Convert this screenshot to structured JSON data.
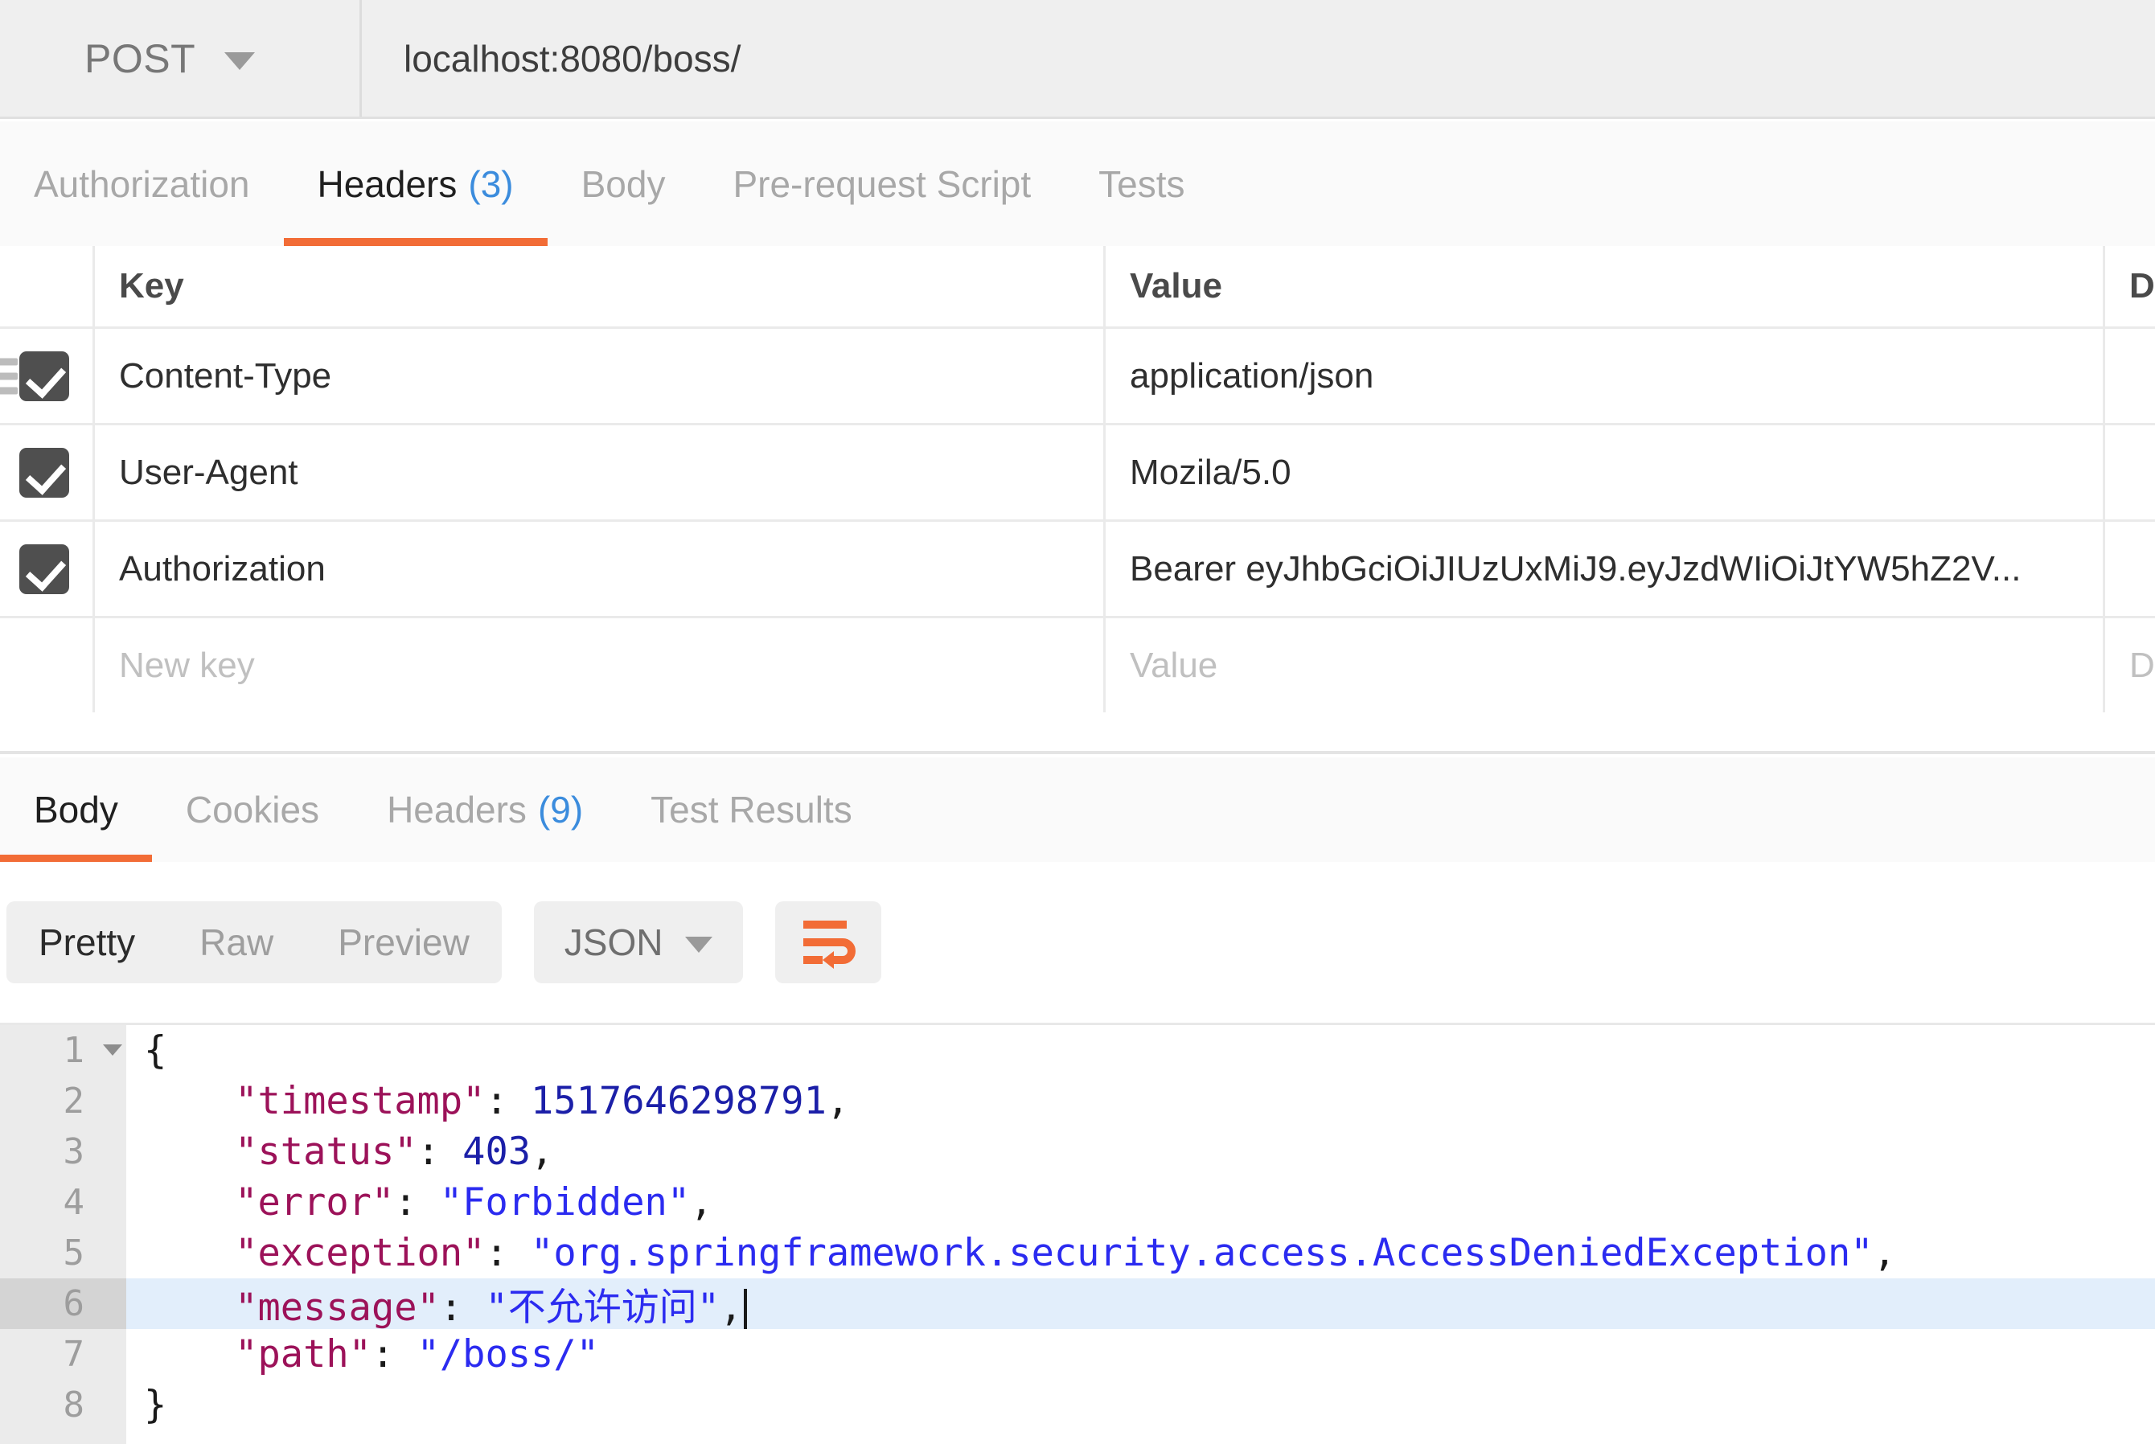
{
  "request_bar": {
    "method": "POST",
    "method_chevron_icon": "chevron-down-icon",
    "url": "localhost:8080/boss/"
  },
  "request_tabs": [
    {
      "label": "Authorization",
      "count": "",
      "active": false
    },
    {
      "label": "Headers",
      "count": "(3)",
      "active": true
    },
    {
      "label": "Body",
      "count": "",
      "active": false
    },
    {
      "label": "Pre-request Script",
      "count": "",
      "active": false
    },
    {
      "label": "Tests",
      "count": "",
      "active": false
    }
  ],
  "headers_table": {
    "columns": {
      "key": "Key",
      "value": "Value",
      "description": "D"
    },
    "rows": [
      {
        "checked": true,
        "key": "Content-Type",
        "value": "application/json",
        "description": "",
        "dragging": true
      },
      {
        "checked": true,
        "key": "User-Agent",
        "value": "Mozila/5.0",
        "description": "",
        "dragging": false
      },
      {
        "checked": true,
        "key": "Authorization",
        "value": "Bearer eyJhbGciOiJIUzUxMiJ9.eyJzdWIiOiJtYW5hZ2V...",
        "description": "",
        "dragging": false
      }
    ],
    "new_row": {
      "key_placeholder": "New key",
      "value_placeholder": "Value",
      "description_placeholder": "D"
    }
  },
  "response_tabs": [
    {
      "label": "Body",
      "count": "",
      "active": true
    },
    {
      "label": "Cookies",
      "count": "",
      "active": false
    },
    {
      "label": "Headers",
      "count": "(9)",
      "active": false
    },
    {
      "label": "Test Results",
      "count": "",
      "active": false
    }
  ],
  "view_toolbar": {
    "modes": [
      {
        "label": "Pretty",
        "active": true
      },
      {
        "label": "Raw",
        "active": false
      },
      {
        "label": "Preview",
        "active": false
      }
    ],
    "format": "JSON",
    "format_chevron_icon": "chevron-down-icon",
    "wrap_button_icon": "word-wrap-icon"
  },
  "response_body": {
    "language": "json",
    "highlighted_line": 6,
    "caret_line": 6,
    "lines": [
      {
        "n": "1",
        "foldable": true,
        "tokens": [
          {
            "t": "punct",
            "v": "{"
          }
        ]
      },
      {
        "n": "2",
        "foldable": false,
        "tokens": [
          {
            "t": "key",
            "v": "    \"timestamp\""
          },
          {
            "t": "punct",
            "v": ": "
          },
          {
            "t": "num",
            "v": "1517646298791"
          },
          {
            "t": "punct",
            "v": ","
          }
        ]
      },
      {
        "n": "3",
        "foldable": false,
        "tokens": [
          {
            "t": "key",
            "v": "    \"status\""
          },
          {
            "t": "punct",
            "v": ": "
          },
          {
            "t": "num",
            "v": "403"
          },
          {
            "t": "punct",
            "v": ","
          }
        ]
      },
      {
        "n": "4",
        "foldable": false,
        "tokens": [
          {
            "t": "key",
            "v": "    \"error\""
          },
          {
            "t": "punct",
            "v": ": "
          },
          {
            "t": "str",
            "v": "\"Forbidden\""
          },
          {
            "t": "punct",
            "v": ","
          }
        ]
      },
      {
        "n": "5",
        "foldable": false,
        "tokens": [
          {
            "t": "key",
            "v": "    \"exception\""
          },
          {
            "t": "punct",
            "v": ": "
          },
          {
            "t": "str",
            "v": "\"org.springframework.security.access.AccessDeniedException\""
          },
          {
            "t": "punct",
            "v": ","
          }
        ]
      },
      {
        "n": "6",
        "foldable": false,
        "tokens": [
          {
            "t": "key",
            "v": "    \"message\""
          },
          {
            "t": "punct",
            "v": ": "
          },
          {
            "t": "str",
            "v": "\"不允许访问\""
          },
          {
            "t": "punct",
            "v": ","
          }
        ]
      },
      {
        "n": "7",
        "foldable": false,
        "tokens": [
          {
            "t": "key",
            "v": "    \"path\""
          },
          {
            "t": "punct",
            "v": ": "
          },
          {
            "t": "str",
            "v": "\"/boss/\""
          }
        ]
      },
      {
        "n": "8",
        "foldable": false,
        "tokens": [
          {
            "t": "punct",
            "v": "}"
          }
        ]
      }
    ]
  },
  "colors": {
    "accent_orange": "#f26c36",
    "link_blue": "#3b8cdd",
    "checkbox_dark": "#4f4f4f",
    "json_key": "#9c1259",
    "json_string": "#2b2bf0",
    "json_number": "#1b1fa8",
    "highlight_row": "#e2eefb"
  }
}
